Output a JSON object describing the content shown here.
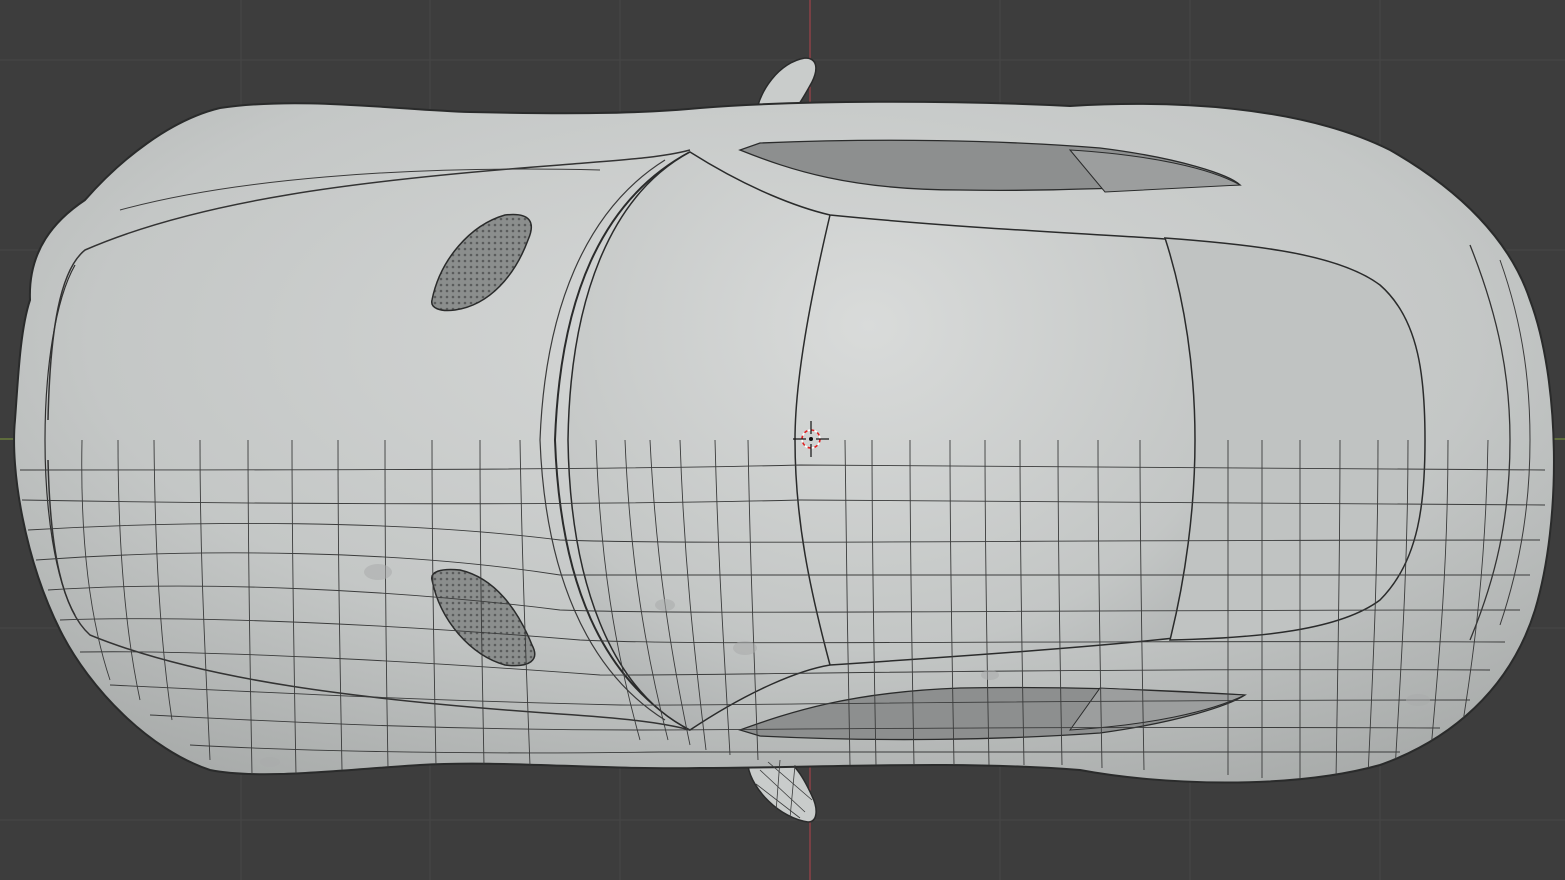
{
  "viewport": {
    "view": "top-orthographic",
    "shading": "solid",
    "overlay": "wireframe-lower-half",
    "colors": {
      "background": "#3d3d3d",
      "grid": "#494949",
      "axis_x": "#7e9b3a",
      "axis_y": "#b3434c",
      "body_light": "#d2d4d3",
      "body_mid": "#bcbfbe",
      "body_dark": "#9ea1a0",
      "glass": "#8d8f8f",
      "edge": "#2a2b2b",
      "wire": "#3a3b3b",
      "cursor_red": "#e02020"
    }
  },
  "model": {
    "icon": "car-mesh",
    "parts": [
      "hood",
      "roof",
      "rear-deck",
      "windshield",
      "rear-window",
      "side-mirror-top",
      "side-mirror-bottom",
      "hood-vent-top",
      "hood-vent-bottom"
    ]
  },
  "cursor": {
    "icon": "3d-cursor-icon"
  }
}
